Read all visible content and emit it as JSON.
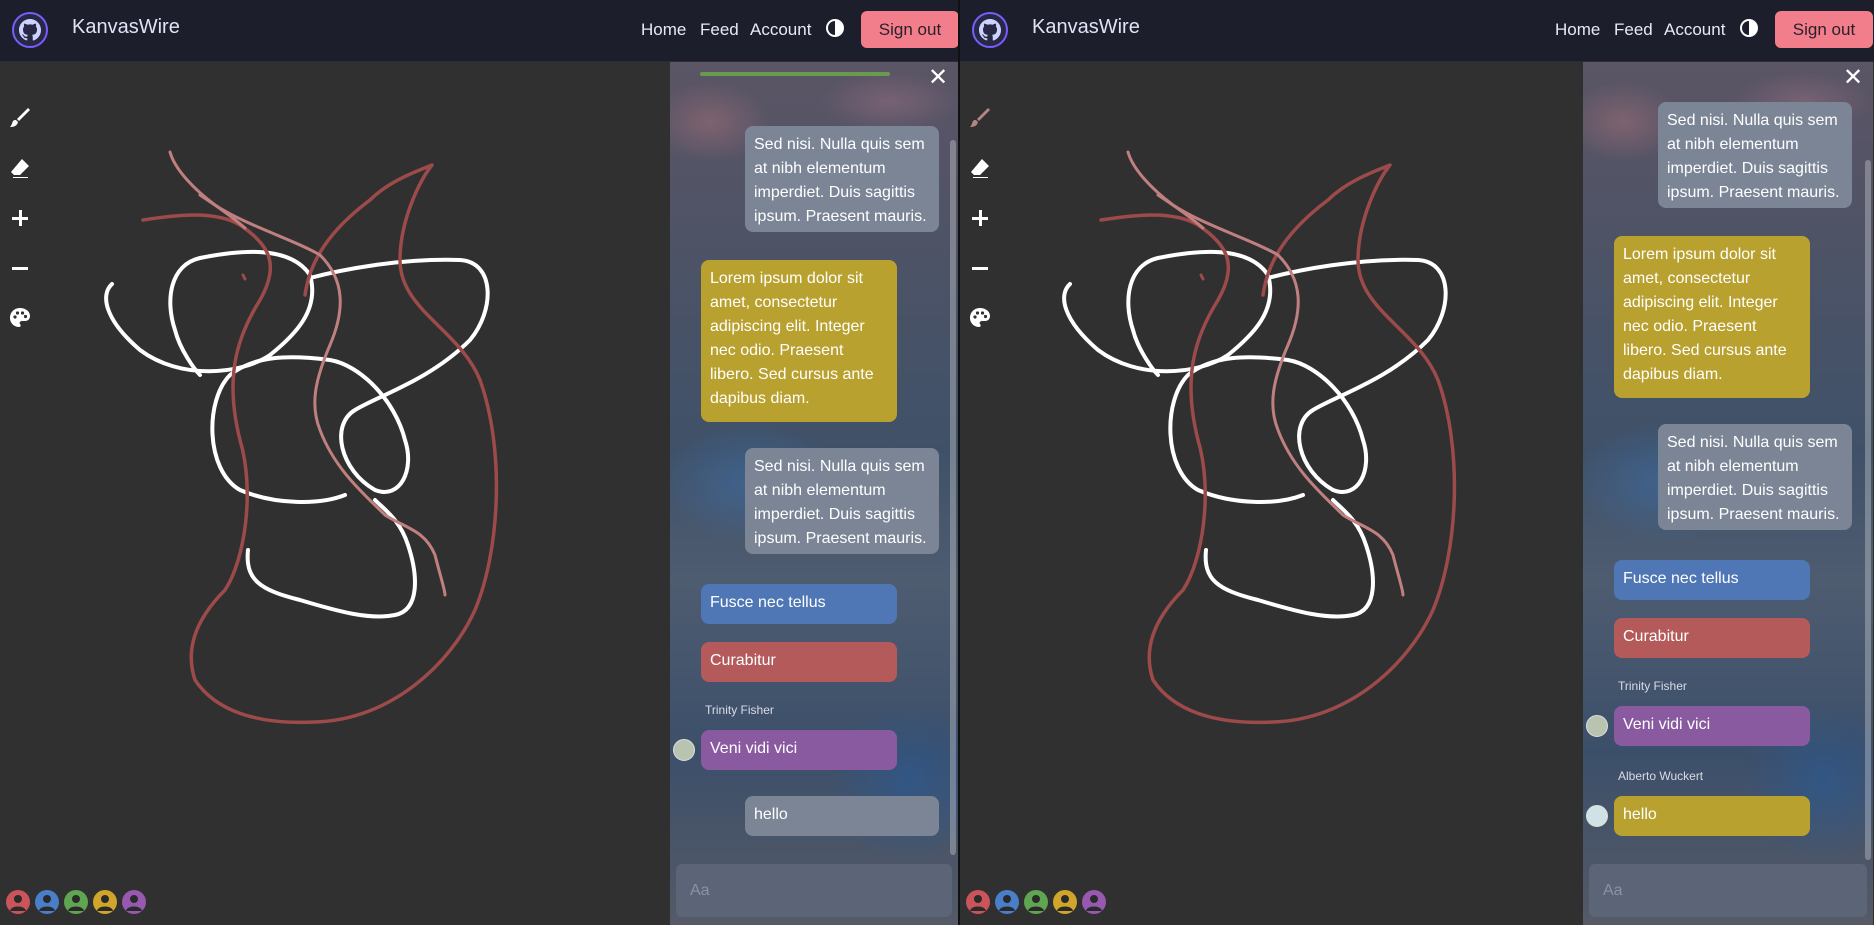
{
  "app": {
    "brand": "KanvasWire"
  },
  "nav": {
    "home": "Home",
    "feed": "Feed",
    "account": "Account",
    "signout": "Sign out"
  },
  "tools": [
    "brush-icon",
    "eraser-icon",
    "plus-icon",
    "minus-icon",
    "palette-icon"
  ],
  "users": [
    {
      "color": "#c9545a"
    },
    {
      "color": "#4a7ec8"
    },
    {
      "color": "#5fa552"
    },
    {
      "color": "#d0a52b"
    },
    {
      "color": "#9559b0"
    }
  ],
  "chat": {
    "placeholder": "Aa",
    "left": {
      "m1": "Sed nisi. Nulla quis sem at nibh elementum imperdiet. Duis sagittis ipsum. Praesent mauris.",
      "m2": "Lorem ipsum dolor sit amet, consectetur adipiscing elit. Integer nec odio. Praesent libero. Sed cursus ante dapibus diam.",
      "m3": "Sed nisi. Nulla quis sem at nibh elementum imperdiet. Duis sagittis ipsum. Praesent mauris.",
      "m4": "Fusce nec tellus",
      "m5": "Curabitur",
      "sender6": "Trinity Fisher",
      "m6": "Veni vidi vici",
      "m7": "hello"
    },
    "right": {
      "m1": "Sed nisi. Nulla quis sem at nibh elementum imperdiet. Duis sagittis ipsum. Praesent mauris.",
      "m2": "Lorem ipsum dolor sit amet, consectetur adipiscing elit. Integer nec odio. Praesent libero. Sed cursus ante dapibus diam.",
      "m3": "Sed nisi. Nulla quis sem at nibh elementum imperdiet. Duis sagittis ipsum. Praesent mauris.",
      "m4": "Fusce nec tellus",
      "m5": "Curabitur",
      "sender6": "Trinity Fisher",
      "m6": "Veni vidi vici",
      "sender7": "Alberto Wuckert",
      "m7": "hello"
    }
  },
  "colors": {
    "stroke_white": "#ffffff",
    "stroke_red": "#9c4a4a",
    "stroke_pink": "#c08080"
  }
}
